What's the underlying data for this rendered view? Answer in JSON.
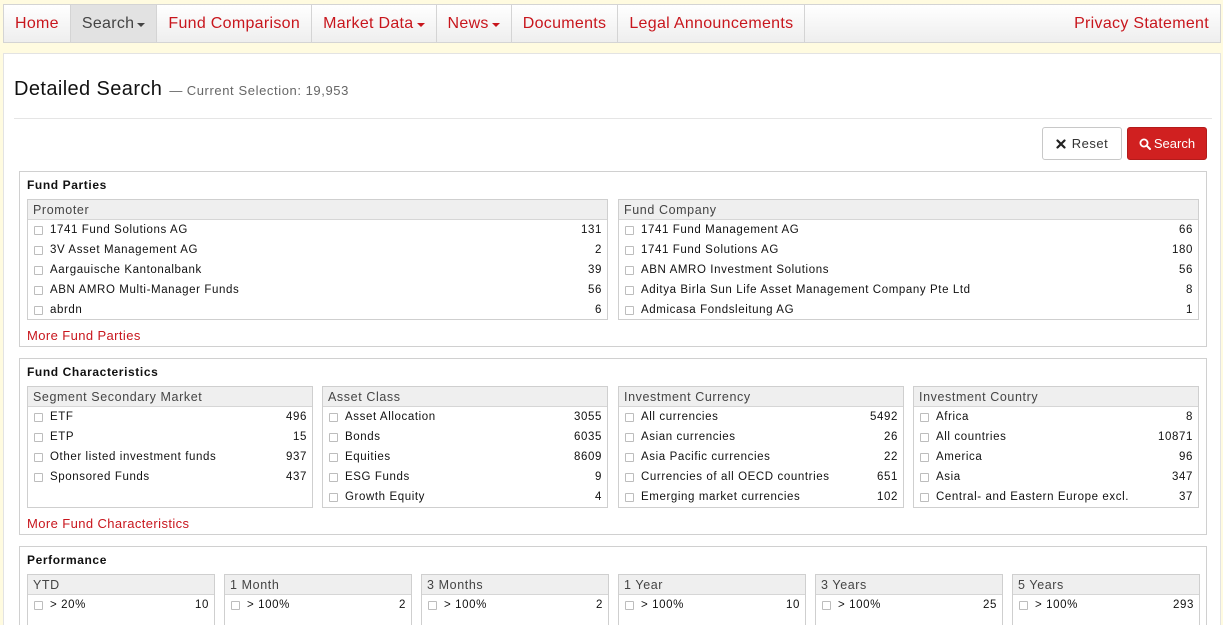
{
  "nav": {
    "items": [
      {
        "label": "Home",
        "active": false,
        "dropdown": false
      },
      {
        "label": "Search",
        "active": true,
        "dropdown": true
      },
      {
        "label": "Fund Comparison",
        "active": false,
        "dropdown": false
      },
      {
        "label": "Market Data",
        "active": false,
        "dropdown": true
      },
      {
        "label": "News",
        "active": false,
        "dropdown": true
      },
      {
        "label": "Documents",
        "active": false,
        "dropdown": false
      },
      {
        "label": "Legal Announcements",
        "active": false,
        "dropdown": false
      }
    ],
    "right_label": "Privacy Statement"
  },
  "header": {
    "title": "Detailed Search",
    "separator": "—",
    "selection_label": "Current Selection:",
    "selection_value": "19,953"
  },
  "buttons": {
    "reset_label": "Reset",
    "search_label": "Search"
  },
  "colors": {
    "accent": "#c8161d",
    "search_button": "#d02020",
    "page_background": "#fffbe0"
  },
  "sections": {
    "fund_parties": {
      "title": "Fund Parties",
      "more_label": "More Fund Parties",
      "boxes": [
        {
          "title": "Promoter",
          "rows": [
            {
              "label": "1741 Fund Solutions AG",
              "count": "131"
            },
            {
              "label": "3V Asset Management AG",
              "count": "2"
            },
            {
              "label": "Aargauische Kantonalbank",
              "count": "39"
            },
            {
              "label": "ABN AMRO Multi-Manager Funds",
              "count": "56"
            },
            {
              "label": "abrdn",
              "count": "6"
            }
          ]
        },
        {
          "title": "Fund Company",
          "rows": [
            {
              "label": "1741 Fund Management AG",
              "count": "66"
            },
            {
              "label": "1741 Fund Solutions AG",
              "count": "180"
            },
            {
              "label": "ABN AMRO Investment Solutions",
              "count": "56"
            },
            {
              "label": "Aditya Birla Sun Life Asset Management Company Pte Ltd",
              "count": "8"
            },
            {
              "label": "Admicasa Fondsleitung AG",
              "count": "1"
            }
          ]
        }
      ]
    },
    "fund_characteristics": {
      "title": "Fund Characteristics",
      "more_label": "More Fund Characteristics",
      "boxes": [
        {
          "title": "Segment Secondary Market",
          "rows": [
            {
              "label": "ETF",
              "count": "496"
            },
            {
              "label": "ETP",
              "count": "15"
            },
            {
              "label": "Other listed investment funds",
              "count": "937"
            },
            {
              "label": "Sponsored Funds",
              "count": "437"
            }
          ]
        },
        {
          "title": "Asset Class",
          "rows": [
            {
              "label": "Asset Allocation",
              "count": "3055"
            },
            {
              "label": "Bonds",
              "count": "6035"
            },
            {
              "label": "Equities",
              "count": "8609"
            },
            {
              "label": "ESG Funds",
              "count": "9"
            },
            {
              "label": "Growth Equity",
              "count": "4"
            }
          ]
        },
        {
          "title": "Investment Currency",
          "rows": [
            {
              "label": "All currencies",
              "count": "5492"
            },
            {
              "label": "Asian currencies",
              "count": "26"
            },
            {
              "label": "Asia Pacific currencies",
              "count": "22"
            },
            {
              "label": "Currencies of all OECD countries",
              "count": "651"
            },
            {
              "label": "Emerging market currencies",
              "count": "102"
            }
          ]
        },
        {
          "title": "Investment Country",
          "rows": [
            {
              "label": "Africa",
              "count": "8"
            },
            {
              "label": "All countries",
              "count": "10871"
            },
            {
              "label": "America",
              "count": "96"
            },
            {
              "label": "Asia",
              "count": "347"
            },
            {
              "label": "Central- and Eastern Europe excl.",
              "count": "37"
            }
          ]
        }
      ]
    },
    "performance": {
      "title": "Performance",
      "boxes": [
        {
          "title": "YTD",
          "rows": [
            {
              "label": "> 20%",
              "count": "10"
            }
          ]
        },
        {
          "title": "1 Month",
          "rows": [
            {
              "label": "> 100%",
              "count": "2"
            }
          ]
        },
        {
          "title": "3 Months",
          "rows": [
            {
              "label": "> 100%",
              "count": "2"
            }
          ]
        },
        {
          "title": "1 Year",
          "rows": [
            {
              "label": "> 100%",
              "count": "10"
            }
          ]
        },
        {
          "title": "3 Years",
          "rows": [
            {
              "label": "> 100%",
              "count": "25"
            }
          ]
        },
        {
          "title": "5 Years",
          "rows": [
            {
              "label": "> 100%",
              "count": "293"
            }
          ]
        }
      ]
    }
  }
}
